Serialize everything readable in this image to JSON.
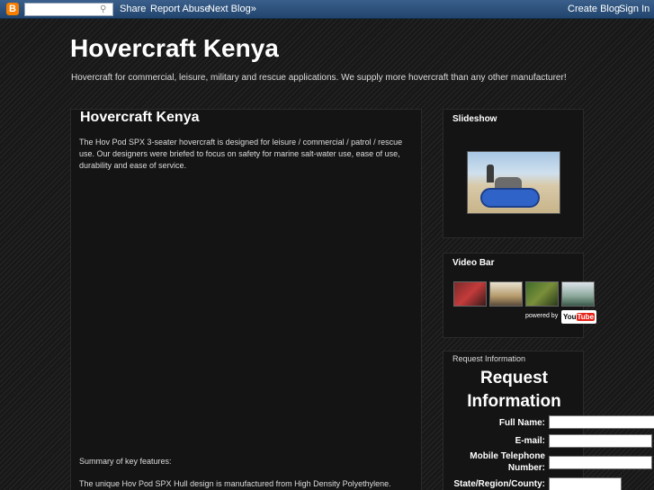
{
  "navbar": {
    "logo": "B",
    "share": "Share",
    "report_abuse": "Report Abuse",
    "next_blog": "Next Blog»",
    "create_blog": "Create Blog",
    "sign_in": "Sign In",
    "search_value": ""
  },
  "header": {
    "title": "Hovercraft Kenya",
    "description": "Hovercraft for commercial, leisure, military and rescue applications. We supply more hovercraft than any other manufacturer!"
  },
  "post": {
    "title": "Hovercraft Kenya",
    "intro": "The Hov Pod SPX 3-seater hovercraft is designed for leisure / commercial / patrol / rescue use. Our designers were briefed to focus on safety for marine salt-water use, ease of use, durability and ease of service.",
    "summary_heading": "Summary of key features:",
    "feature_1": "The unique Hov Pod SPX Hull design is manufactured from High Density Polyethylene."
  },
  "sidebar": {
    "slideshow_title": "Slideshow",
    "videobar_title": "Video Bar",
    "powered_by": "powered by",
    "youtube_you": "You",
    "youtube_tube": "Tube",
    "request_small": "Request Information",
    "request_big_1": "Request",
    "request_big_2": "Information",
    "form": {
      "full_name": "Full Name:",
      "email": "E-mail:",
      "mobile_1": "Mobile Telephone",
      "mobile_2": "Number:",
      "state": "State/Region/County:"
    }
  },
  "colors": {
    "navbar": "#2c5280",
    "accent": "#f57d00"
  }
}
